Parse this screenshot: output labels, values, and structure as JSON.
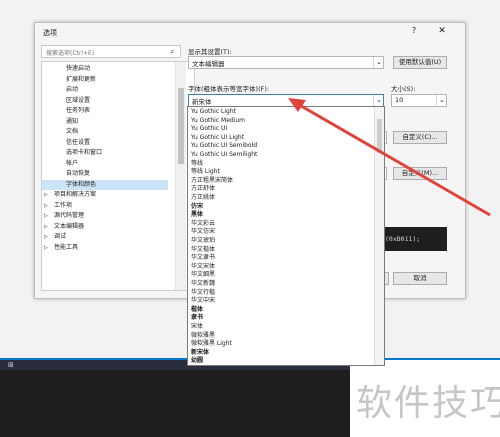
{
  "dialog": {
    "title": "选项",
    "help": "?",
    "close": "✕"
  },
  "search": {
    "placeholder": "搜索选项(Ctrl+E)"
  },
  "tree": {
    "items": [
      {
        "label": "快速启动",
        "indent": 1,
        "expander": "",
        "selected": false
      },
      {
        "label": "扩展和更新",
        "indent": 1,
        "expander": "",
        "selected": false
      },
      {
        "label": "启动",
        "indent": 1,
        "expander": "",
        "selected": false
      },
      {
        "label": "区域设置",
        "indent": 1,
        "expander": "",
        "selected": false
      },
      {
        "label": "任务列表",
        "indent": 1,
        "expander": "",
        "selected": false
      },
      {
        "label": "通知",
        "indent": 1,
        "expander": "",
        "selected": false
      },
      {
        "label": "文档",
        "indent": 1,
        "expander": "",
        "selected": false
      },
      {
        "label": "信任设置",
        "indent": 1,
        "expander": "",
        "selected": false
      },
      {
        "label": "选项卡和窗口",
        "indent": 1,
        "expander": "",
        "selected": false
      },
      {
        "label": "帐户",
        "indent": 1,
        "expander": "",
        "selected": false
      },
      {
        "label": "自动恢复",
        "indent": 1,
        "expander": "",
        "selected": false
      },
      {
        "label": "字体和颜色",
        "indent": 1,
        "expander": "",
        "selected": true
      },
      {
        "label": "项目和解决方案",
        "indent": 0,
        "expander": "▷",
        "selected": false
      },
      {
        "label": "工作项",
        "indent": 0,
        "expander": "▷",
        "selected": false
      },
      {
        "label": "源代码管理",
        "indent": 0,
        "expander": "▷",
        "selected": false
      },
      {
        "label": "文本编辑器",
        "indent": 0,
        "expander": "▷",
        "selected": false
      },
      {
        "label": "调试",
        "indent": 0,
        "expander": "▷",
        "selected": false
      },
      {
        "label": "性能工具",
        "indent": 0,
        "expander": "▷",
        "selected": false
      }
    ]
  },
  "settings": {
    "show_settings_for_label": "显示其设置(T):",
    "show_settings_for_value": "文本编辑器",
    "use_defaults_button": "使用默认值(U)",
    "font_label": "字体(粗体表示等宽字体)(F):",
    "font_value": "新宋体",
    "size_label": "大小(S):",
    "size_value": "10",
    "custom1_button": "自定义(C)...",
    "custom2_button": "自定义(M)...",
    "preview_text": "(0xB011);",
    "cancel_button": "取消"
  },
  "font_list": {
    "items": [
      {
        "label": "Yu Gothic Light",
        "bold": false
      },
      {
        "label": "Yu Gothic Medium",
        "bold": false
      },
      {
        "label": "Yu Gothic UI",
        "bold": false
      },
      {
        "label": "Yu Gothic UI Light",
        "bold": false
      },
      {
        "label": "Yu Gothic UI Semibold",
        "bold": false
      },
      {
        "label": "Yu Gothic UI Semilight",
        "bold": false
      },
      {
        "label": "等线",
        "bold": false
      },
      {
        "label": "等线 Light",
        "bold": false
      },
      {
        "label": "方正粗黑宋简体",
        "bold": false
      },
      {
        "label": "方正舒体",
        "bold": false
      },
      {
        "label": "方正姚体",
        "bold": false
      },
      {
        "label": "仿宋",
        "bold": true
      },
      {
        "label": "黑体",
        "bold": true
      },
      {
        "label": "华文彩云",
        "bold": false
      },
      {
        "label": "华文仿宋",
        "bold": false
      },
      {
        "label": "华文琥珀",
        "bold": false
      },
      {
        "label": "华文楷体",
        "bold": false
      },
      {
        "label": "华文隶书",
        "bold": false
      },
      {
        "label": "华文宋体",
        "bold": false
      },
      {
        "label": "华文细黑",
        "bold": false
      },
      {
        "label": "华文新魏",
        "bold": false
      },
      {
        "label": "华文行楷",
        "bold": false
      },
      {
        "label": "华文中宋",
        "bold": false
      },
      {
        "label": "楷体",
        "bold": true
      },
      {
        "label": "隶书",
        "bold": true
      },
      {
        "label": "宋体",
        "bold": false
      },
      {
        "label": "微软雅黑",
        "bold": false
      },
      {
        "label": "微软雅黑 Light",
        "bold": false
      },
      {
        "label": "新宋体",
        "bold": true
      },
      {
        "label": "幼圆",
        "bold": true
      }
    ]
  },
  "watermark": "软件技巧",
  "colors": {
    "selection": "#cce4f7",
    "arrow": "#e0433a",
    "accent": "#007acc"
  }
}
